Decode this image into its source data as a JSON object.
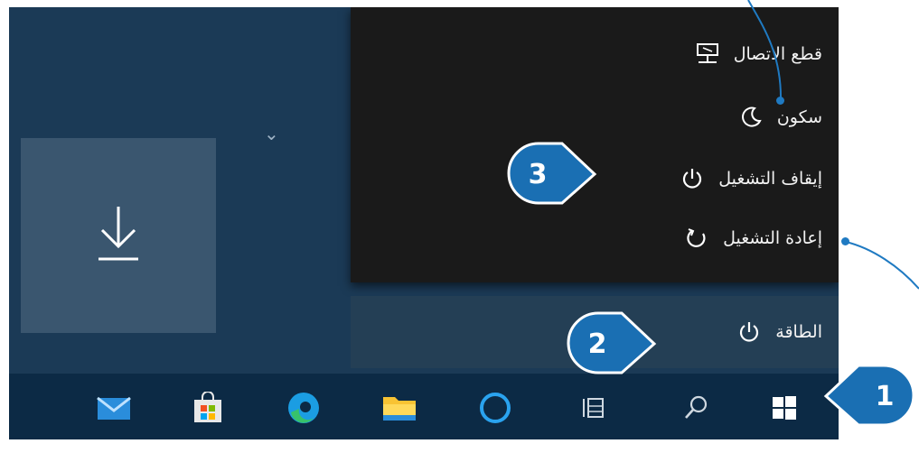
{
  "power_menu": {
    "items": [
      {
        "label": "قطع الاتصال",
        "icon": "disconnect-icon"
      },
      {
        "label": "سكون",
        "icon": "sleep-icon"
      },
      {
        "label": "إيقاف التشغيل",
        "icon": "shutdown-icon"
      },
      {
        "label": "إعادة التشغيل",
        "icon": "restart-icon"
      }
    ]
  },
  "power_button": {
    "label": "الطاقة",
    "icon": "power-icon"
  },
  "tiles": {
    "download_icon": "download-icon",
    "expand_icon": "chevron-down-icon"
  },
  "taskbar": {
    "icons": [
      "mail-icon",
      "store-icon",
      "edge-icon",
      "file-explorer-icon",
      "cortana-icon",
      "task-view-icon",
      "search-icon",
      "windows-start-icon"
    ]
  },
  "callouts": [
    {
      "number": "1",
      "target": "start button"
    },
    {
      "number": "2",
      "target": "power"
    },
    {
      "number": "3",
      "target": "shut down"
    }
  ],
  "colors": {
    "accent": "#1f7ac2",
    "callout": "#1a6fb3",
    "taskbar": "#0c2a45",
    "menu": "#1a1a1a"
  }
}
